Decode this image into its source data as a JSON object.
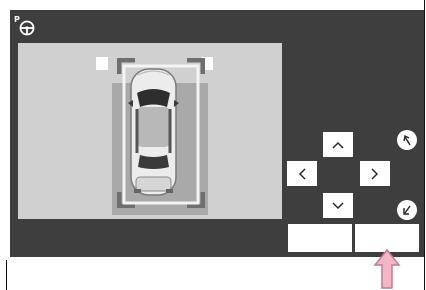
{
  "screen": {
    "background": "#3e3e3e",
    "camera_background": "#d0d0d0",
    "indicator_icon": "parking-steering-assist-icon"
  },
  "controls": {
    "up": {
      "icon": "chevron-up-icon"
    },
    "down": {
      "icon": "chevron-down-icon"
    },
    "left": {
      "icon": "chevron-left-icon"
    },
    "right": {
      "icon": "chevron-right-icon"
    },
    "rotate_left": {
      "icon": "rotate-counterclockwise-icon"
    },
    "rotate_right": {
      "icon": "rotate-clockwise-icon"
    },
    "button_left": {
      "label": ""
    },
    "button_right": {
      "label": ""
    }
  },
  "annotation": {
    "pointer_color": "#f2b6c7",
    "pointer_stroke": "#c27a92",
    "pointer_target": "button_right"
  }
}
